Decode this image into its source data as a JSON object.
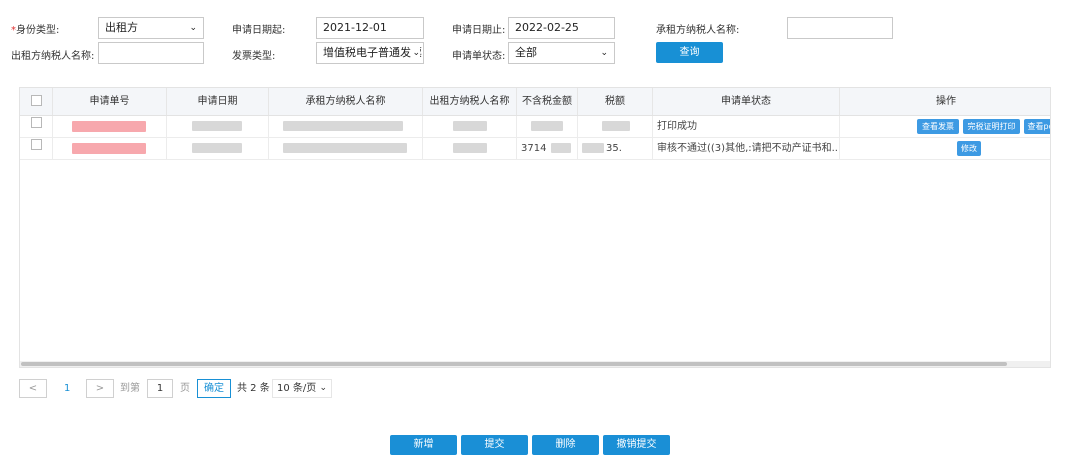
{
  "filters": {
    "identity_type_label": "身份类型:",
    "identity_type_value": "出租方",
    "apply_date_start_label": "申请日期起:",
    "apply_date_start_value": "2021-12-01",
    "apply_date_end_label": "申请日期止:",
    "apply_date_end_value": "2022-02-25",
    "lessee_taxpayer_label": "承租方纳税人名称:",
    "lessee_taxpayer_value": "",
    "lessor_taxpayer_label": "出租方纳税人名称:",
    "lessor_taxpayer_value": "",
    "invoice_type_label": "发票类型:",
    "invoice_type_value": "增值税电子普通发票",
    "status_label": "申请单状态:",
    "status_value": "全部",
    "query_button": "查询"
  },
  "table": {
    "headers": [
      "申请单号",
      "申请日期",
      "承租方纳税人名称",
      "出租方纳税人名称",
      "不含税金额",
      "税额",
      "申请单状态",
      "操作"
    ],
    "rows": [
      {
        "status": "打印成功",
        "actions": [
          "查看发票",
          "完税证明打印",
          "查看pdf"
        ]
      },
      {
        "amount_partial": "3714",
        "tax_partial": "35.",
        "status": "审核不通过((3)其他,:请把不动产证书和...",
        "actions": [
          "修改"
        ]
      }
    ]
  },
  "pagination": {
    "prev": "<",
    "current_page": "1",
    "next": ">",
    "goto_label": "到第",
    "goto_value": "1",
    "page_unit": "页",
    "confirm": "确定",
    "total": "共 2 条",
    "page_size": "10 条/页"
  },
  "actions": {
    "add": "新增",
    "submit": "提交",
    "delete": "删除",
    "revoke": "撤销提交"
  }
}
